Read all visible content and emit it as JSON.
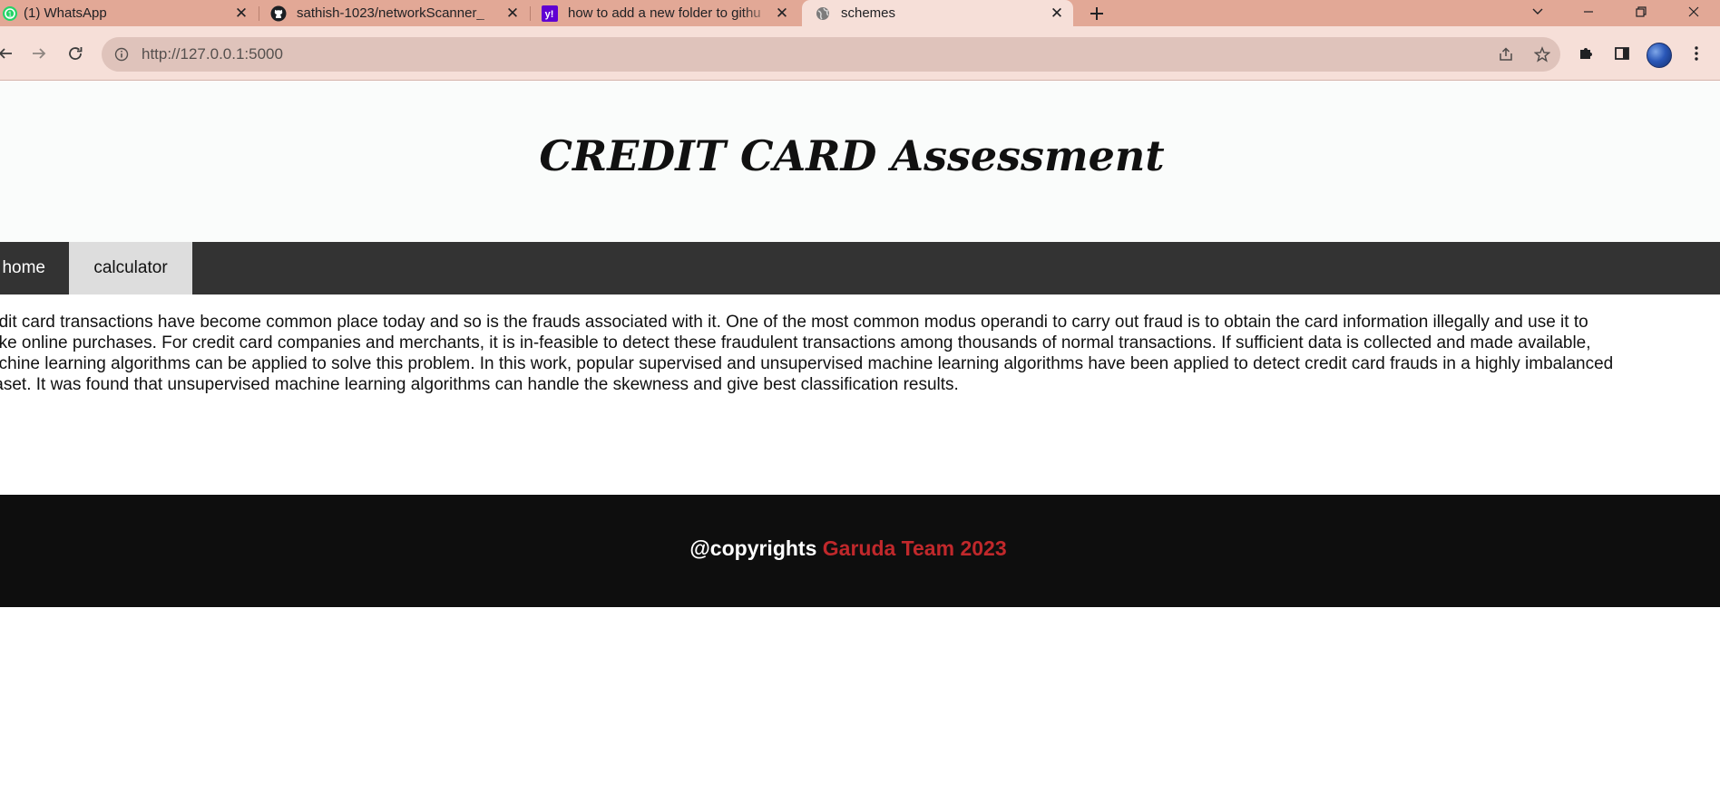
{
  "browser": {
    "tabs": [
      {
        "title": "(1) WhatsApp",
        "icon": "whatsapp-icon",
        "active": false
      },
      {
        "title": "sathish-1023/networkScanner_",
        "icon": "github-icon",
        "active": false
      },
      {
        "title": "how to add a new folder to githu",
        "icon": "yahoo-icon",
        "active": false
      },
      {
        "title": "schemes",
        "icon": "globe-icon",
        "active": true
      }
    ],
    "url": "http://127.0.0.1:5000",
    "tabstrip_color": "#e2a896",
    "toolbar_color": "#f6dfd8"
  },
  "page": {
    "title": "CREDIT CARD Assessment",
    "nav": [
      {
        "label": "home",
        "selected": false
      },
      {
        "label": "calculator",
        "selected": true
      }
    ],
    "paragraph_lines": [
      "edit card transactions have become common place today and so is the frauds associated with it. One of the most common modus operandi to carry out fraud is to obtain the card information illegally and use it to",
      "ake online purchases. For credit card companies and merchants, it is in-feasible to detect these fraudulent transactions among thousands of normal transactions. If sufficient data is collected and made available,",
      "achine learning algorithms can be applied to solve this problem. In this work, popular supervised and unsupervised machine learning algorithms have been applied to detect credit card frauds in a highly imbalanced",
      "taset. It was found that unsupervised machine learning algorithms can handle the skewness and give best classification results."
    ],
    "footer": {
      "prefix": "@copyrights",
      "brand": "Garuda Team 2023",
      "brand_color": "#c0282b"
    }
  }
}
